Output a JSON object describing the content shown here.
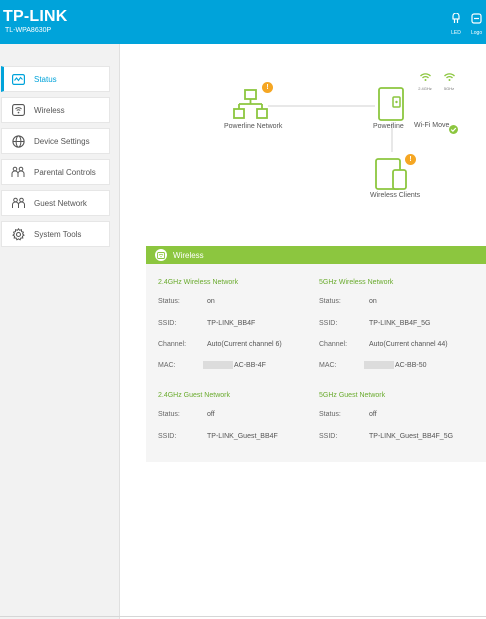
{
  "header": {
    "logo": "TP-LINK",
    "model": "TL-WPA8630P",
    "led_label": "LED",
    "logout_label": "Logo"
  },
  "sidebar": {
    "items": [
      {
        "label": "Status",
        "icon": "status-icon",
        "active": true
      },
      {
        "label": "Wireless",
        "icon": "wireless-icon"
      },
      {
        "label": "Device Settings",
        "icon": "globe-icon"
      },
      {
        "label": "Parental Controls",
        "icon": "family-icon"
      },
      {
        "label": "Guest Network",
        "icon": "guest-icon"
      },
      {
        "label": "System Tools",
        "icon": "gear-icon"
      }
    ]
  },
  "topology": {
    "powerline_network": "Powerline Network",
    "powerline": "Powerline",
    "wifi_move": "Wi-Fi Move",
    "wireless_clients": "Wireless Clients",
    "band_24": "2.4GHz",
    "band_5": "5GHz",
    "alert_badge": "!"
  },
  "wireless": {
    "title": "Wireless",
    "net24": {
      "title": "2.4GHz Wireless Network",
      "status_key": "Status:",
      "status": "on",
      "ssid_key": "SSID:",
      "ssid": "TP-LINK_BB4F",
      "channel_key": "Channel:",
      "channel": "Auto(Current channel 6)",
      "mac_key": "MAC:",
      "mac": "AC-BB-4F"
    },
    "net5": {
      "title": "5GHz Wireless Network",
      "status_key": "Status:",
      "status": "on",
      "ssid_key": "SSID:",
      "ssid": "TP-LINK_BB4F_5G",
      "channel_key": "Channel:",
      "channel": "Auto(Current channel 44)",
      "mac_key": "MAC:",
      "mac": "AC-BB-50"
    },
    "guest24": {
      "title": "2.4GHz Guest Network",
      "status_key": "Status:",
      "status": "off",
      "ssid_key": "SSID:",
      "ssid": "TP-LINK_Guest_BB4F"
    },
    "guest5": {
      "title": "5GHz Guest Network",
      "status_key": "Status:",
      "status": "off",
      "ssid_key": "SSID:",
      "ssid": "TP-LINK_Guest_BB4F_5G"
    }
  },
  "colors": {
    "brand_blue": "#00a3da",
    "accent_green": "#8cc63f",
    "alert_orange": "#f5a623"
  }
}
